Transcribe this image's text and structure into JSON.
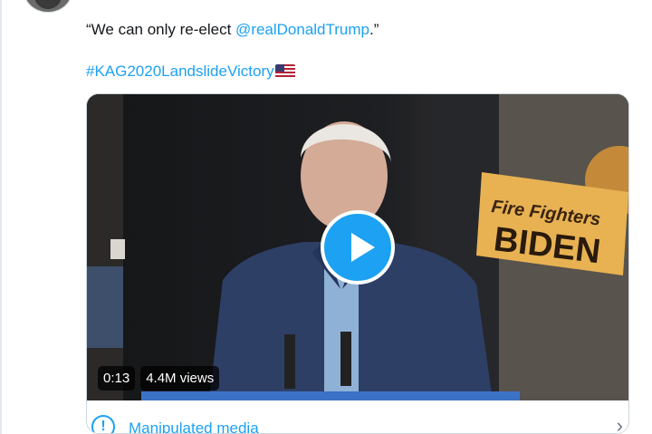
{
  "tweet": {
    "quote_text": "“We can only re-elect ",
    "mention": "@realDonaldTrump",
    "quote_end": ".”",
    "hashtag": "#KAG2020LandslideVictory"
  },
  "video": {
    "duration": "0:13",
    "views": "4.4M views",
    "sign_line1": "Fire Fighters",
    "sign_line2": "BIDEN"
  },
  "notice": {
    "label": "Manipulated media"
  },
  "icons": {
    "play": "play-icon",
    "info": "info-icon",
    "chevron": "chevron-right-icon",
    "flag": "us-flag-icon"
  },
  "colors": {
    "link": "#1da1f2",
    "text": "#14171a",
    "muted": "#657786"
  }
}
